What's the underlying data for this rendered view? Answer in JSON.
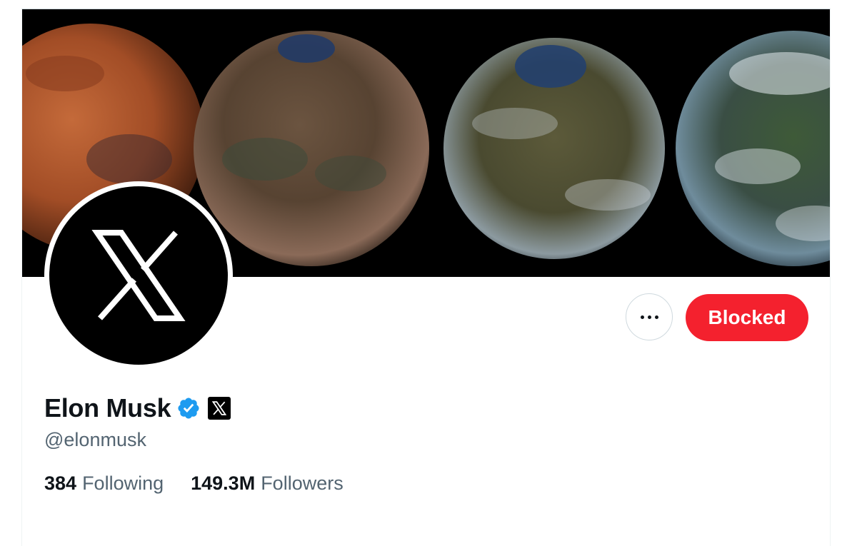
{
  "profile": {
    "display_name": "Elon Musk",
    "handle": "@elonmusk",
    "verified_icon": "verified-badge-icon",
    "affiliate_icon": "x-affiliate-badge-icon",
    "avatar_icon": "x-logo-icon"
  },
  "actions": {
    "more_icon": "more-dots-icon",
    "blocked_label": "Blocked"
  },
  "stats": {
    "following_count": "384",
    "following_label": "Following",
    "followers_count": "149.3M",
    "followers_label": "Followers"
  },
  "colors": {
    "blocked_bg": "#f4212e",
    "verified_blue": "#1d9bf0",
    "primary_text": "#0f1419",
    "secondary_text": "#536471",
    "banner_bg": "#000000"
  }
}
